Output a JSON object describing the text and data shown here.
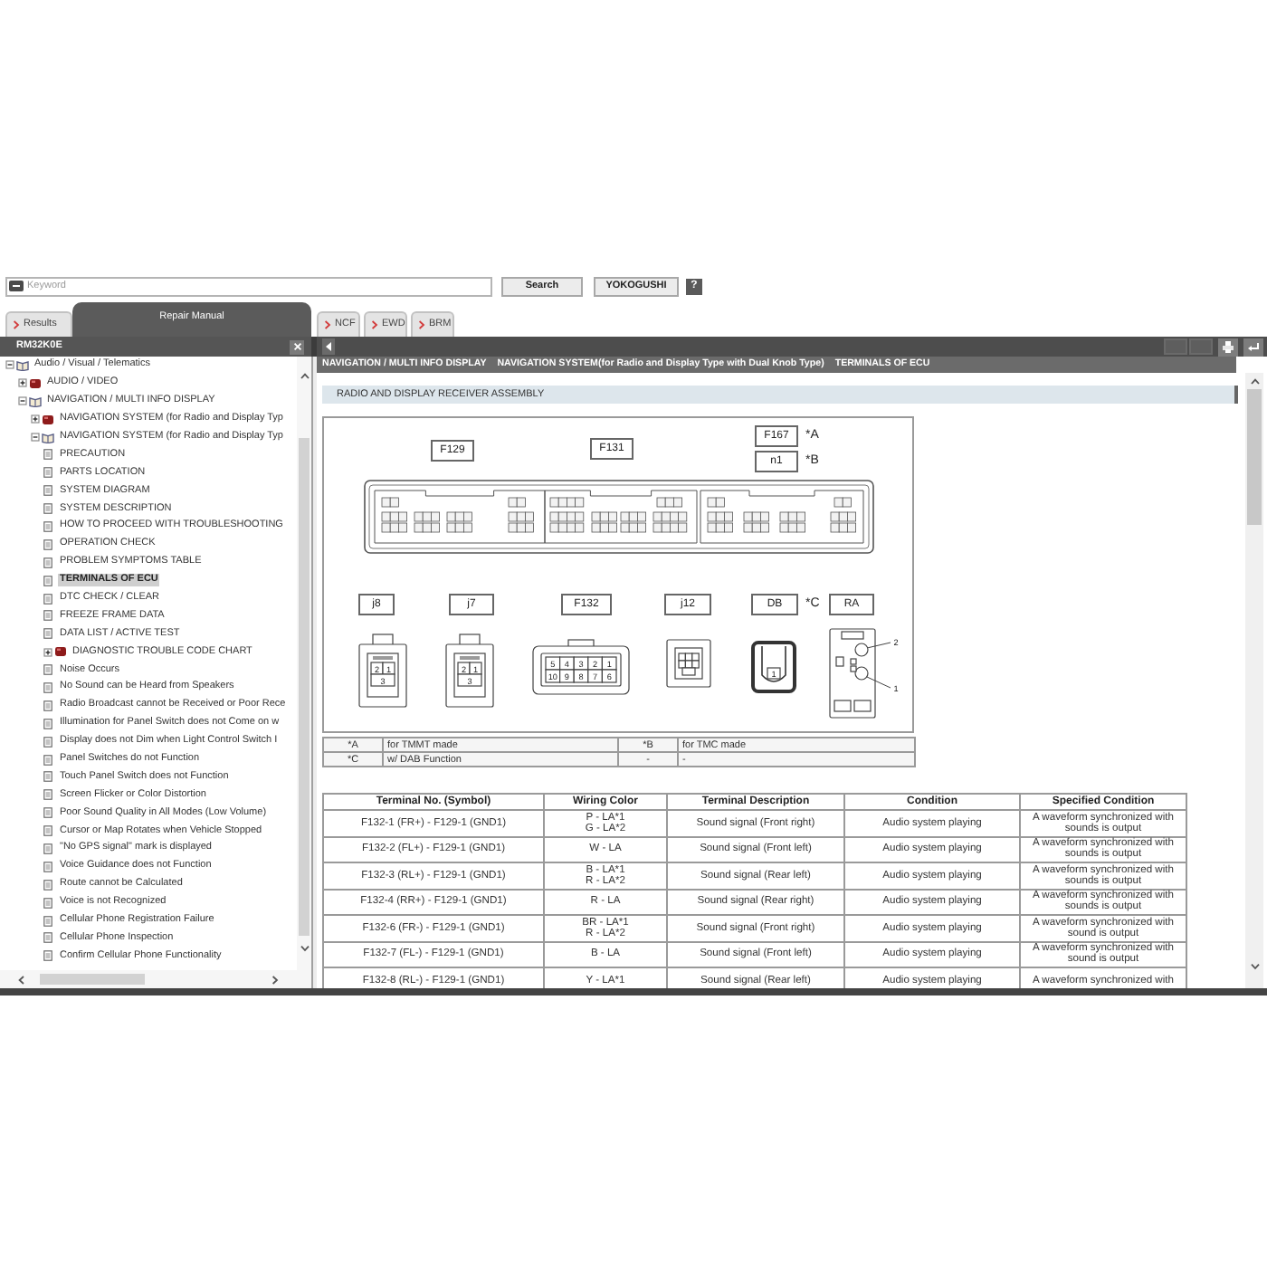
{
  "search": {
    "placeholder": "Keyword",
    "buttons": [
      "Search",
      "YOKOGUSHI"
    ],
    "help": "?"
  },
  "sidebar_tabs": [
    {
      "label": "Results",
      "selected": false
    },
    {
      "label": "Repair Manual",
      "selected": true
    }
  ],
  "viewer_tabs": [
    {
      "label": "NCF",
      "selected": false
    },
    {
      "label": "EWD",
      "selected": false
    },
    {
      "label": "BRM",
      "selected": false
    }
  ],
  "sidebar": {
    "title": "RM32K0E",
    "tree": [
      {
        "label": "Audio / Visual / Telematics",
        "kind": "folder",
        "expanded": true,
        "selected": false,
        "children": [
          {
            "label": "AUDIO / VIDEO",
            "kind": "folder",
            "expanded": false,
            "selected": false
          },
          {
            "label": "NAVIGATION / MULTI INFO DISPLAY",
            "kind": "folder",
            "expanded": true,
            "selected": false,
            "children": [
              {
                "label": "NAVIGATION SYSTEM (for Radio and Display Typ",
                "kind": "folder",
                "expanded": false,
                "selected": false
              },
              {
                "label": "NAVIGATION SYSTEM (for Radio and Display Typ",
                "kind": "folder",
                "expanded": true,
                "selected": false,
                "children": [
                  {
                    "label": "PRECAUTION",
                    "kind": "page",
                    "selected": false
                  },
                  {
                    "label": "PARTS LOCATION",
                    "kind": "page",
                    "selected": false
                  },
                  {
                    "label": "SYSTEM DIAGRAM",
                    "kind": "page",
                    "selected": false
                  },
                  {
                    "label": "SYSTEM DESCRIPTION",
                    "kind": "page",
                    "selected": false
                  },
                  {
                    "label": "HOW TO PROCEED WITH TROUBLESHOOTING",
                    "kind": "page",
                    "selected": false
                  },
                  {
                    "label": "OPERATION CHECK",
                    "kind": "page",
                    "selected": false
                  },
                  {
                    "label": "PROBLEM SYMPTOMS TABLE",
                    "kind": "page",
                    "selected": false
                  },
                  {
                    "label": "TERMINALS OF ECU",
                    "kind": "page",
                    "selected": true
                  },
                  {
                    "label": "DTC CHECK / CLEAR",
                    "kind": "page",
                    "selected": false
                  },
                  {
                    "label": "FREEZE FRAME DATA",
                    "kind": "page",
                    "selected": false
                  },
                  {
                    "label": "DATA LIST / ACTIVE TEST",
                    "kind": "page",
                    "selected": false
                  },
                  {
                    "label": "DIAGNOSTIC TROUBLE CODE CHART",
                    "kind": "folder",
                    "expanded": false,
                    "selected": false
                  },
                  {
                    "label": "Noise Occurs",
                    "kind": "page",
                    "selected": false
                  },
                  {
                    "label": "No Sound can be Heard from Speakers",
                    "kind": "page",
                    "selected": false
                  },
                  {
                    "label": "Radio Broadcast cannot be Received or Poor Rece",
                    "kind": "page",
                    "selected": false
                  },
                  {
                    "label": "Illumination for Panel Switch does not Come on w",
                    "kind": "page",
                    "selected": false
                  },
                  {
                    "label": "Display does not Dim when Light Control Switch I",
                    "kind": "page",
                    "selected": false
                  },
                  {
                    "label": "Panel Switches do not Function",
                    "kind": "page",
                    "selected": false
                  },
                  {
                    "label": "Touch Panel Switch does not Function",
                    "kind": "page",
                    "selected": false
                  },
                  {
                    "label": "Screen Flicker or Color Distortion",
                    "kind": "page",
                    "selected": false
                  },
                  {
                    "label": "Poor Sound Quality in All Modes (Low Volume)",
                    "kind": "page",
                    "selected": false
                  },
                  {
                    "label": "Cursor or Map Rotates when Vehicle Stopped",
                    "kind": "page",
                    "selected": false
                  },
                  {
                    "label": "\"No GPS signal\" mark is displayed",
                    "kind": "page",
                    "selected": false
                  },
                  {
                    "label": "Voice Guidance does not Function",
                    "kind": "page",
                    "selected": false
                  },
                  {
                    "label": "Route cannot be Calculated",
                    "kind": "page",
                    "selected": false
                  },
                  {
                    "label": "Voice is not Recognized",
                    "kind": "page",
                    "selected": false
                  },
                  {
                    "label": "Cellular Phone Registration Failure",
                    "kind": "page",
                    "selected": false
                  },
                  {
                    "label": "Cellular Phone Inspection",
                    "kind": "page",
                    "selected": false
                  },
                  {
                    "label": "Confirm Cellular Phone Functionality",
                    "kind": "page",
                    "selected": false
                  }
                ]
              }
            ]
          }
        ]
      }
    ]
  },
  "viewer": {
    "breadcrumb": [
      "NAVIGATION / MULTI INFO DISPLAY",
      "NAVIGATION SYSTEM(for Radio and Display Type with Dual Knob Type)",
      "TERMINALS OF ECU"
    ],
    "section_title": "RADIO AND DISPLAY RECEIVER ASSEMBLY",
    "diagram": {
      "ecu_labels": [
        {
          "label": "F129"
        },
        {
          "label": "F131"
        },
        {
          "label": "F167",
          "note": "*A"
        },
        {
          "label": "n1",
          "note": "*B"
        }
      ],
      "connectors": [
        {
          "label": "j8",
          "kind": "three_pin",
          "pins": [
            "2",
            "1",
            "3"
          ]
        },
        {
          "label": "j7",
          "kind": "three_pin",
          "pins": [
            "2",
            "1",
            "3"
          ]
        },
        {
          "label": "F132",
          "kind": "ten_pin",
          "pins": [
            "5",
            "4",
            "3",
            "2",
            "1",
            "10",
            "9",
            "8",
            "7",
            "6"
          ]
        },
        {
          "label": "j12",
          "kind": "six_pin"
        },
        {
          "label": "DB",
          "note": "*C",
          "kind": "coax",
          "pins": [
            "1"
          ]
        },
        {
          "label": "RA",
          "kind": "antenna",
          "callouts": [
            "2",
            "1"
          ]
        }
      ]
    },
    "legend": [
      [
        "*A",
        "for TMMT made",
        "*B",
        "for TMC made"
      ],
      [
        "*C",
        "w/ DAB Function",
        "-",
        "-"
      ]
    ],
    "table": {
      "columns": [
        "Terminal No. (Symbol)",
        "Wiring Color",
        "Terminal Description",
        "Condition",
        "Specified Condition"
      ],
      "rows": [
        [
          "F132-1 (FR+) - F129-1 (GND1)",
          "P - LA*1\nG - LA*2",
          "Sound signal (Front right)",
          "Audio system playing",
          "A waveform synchronized with sounds is output"
        ],
        [
          "F132-2 (FL+) - F129-1 (GND1)",
          "W - LA",
          "Sound signal (Front left)",
          "Audio system playing",
          "A waveform synchronized with sounds is output"
        ],
        [
          "F132-3 (RL+) - F129-1 (GND1)",
          "B - LA*1\nR - LA*2",
          "Sound signal (Rear left)",
          "Audio system playing",
          "A waveform synchronized with sounds is output"
        ],
        [
          "F132-4 (RR+) - F129-1 (GND1)",
          "R - LA",
          "Sound signal (Rear right)",
          "Audio system playing",
          "A waveform synchronized with sounds is output"
        ],
        [
          "F132-6 (FR-) - F129-1 (GND1)",
          "BR - LA*1\nR - LA*2",
          "Sound signal (Front right)",
          "Audio system playing",
          "A waveform synchronized with sound is output"
        ],
        [
          "F132-7 (FL-) - F129-1 (GND1)",
          "B - LA",
          "Sound signal (Front left)",
          "Audio system playing",
          "A waveform synchronized with sound is output"
        ],
        [
          "F132-8 (RL-) - F129-1 (GND1)",
          "Y - LA*1",
          "Sound signal (Rear left)",
          "Audio system playing",
          "A waveform synchronized with"
        ]
      ]
    }
  }
}
